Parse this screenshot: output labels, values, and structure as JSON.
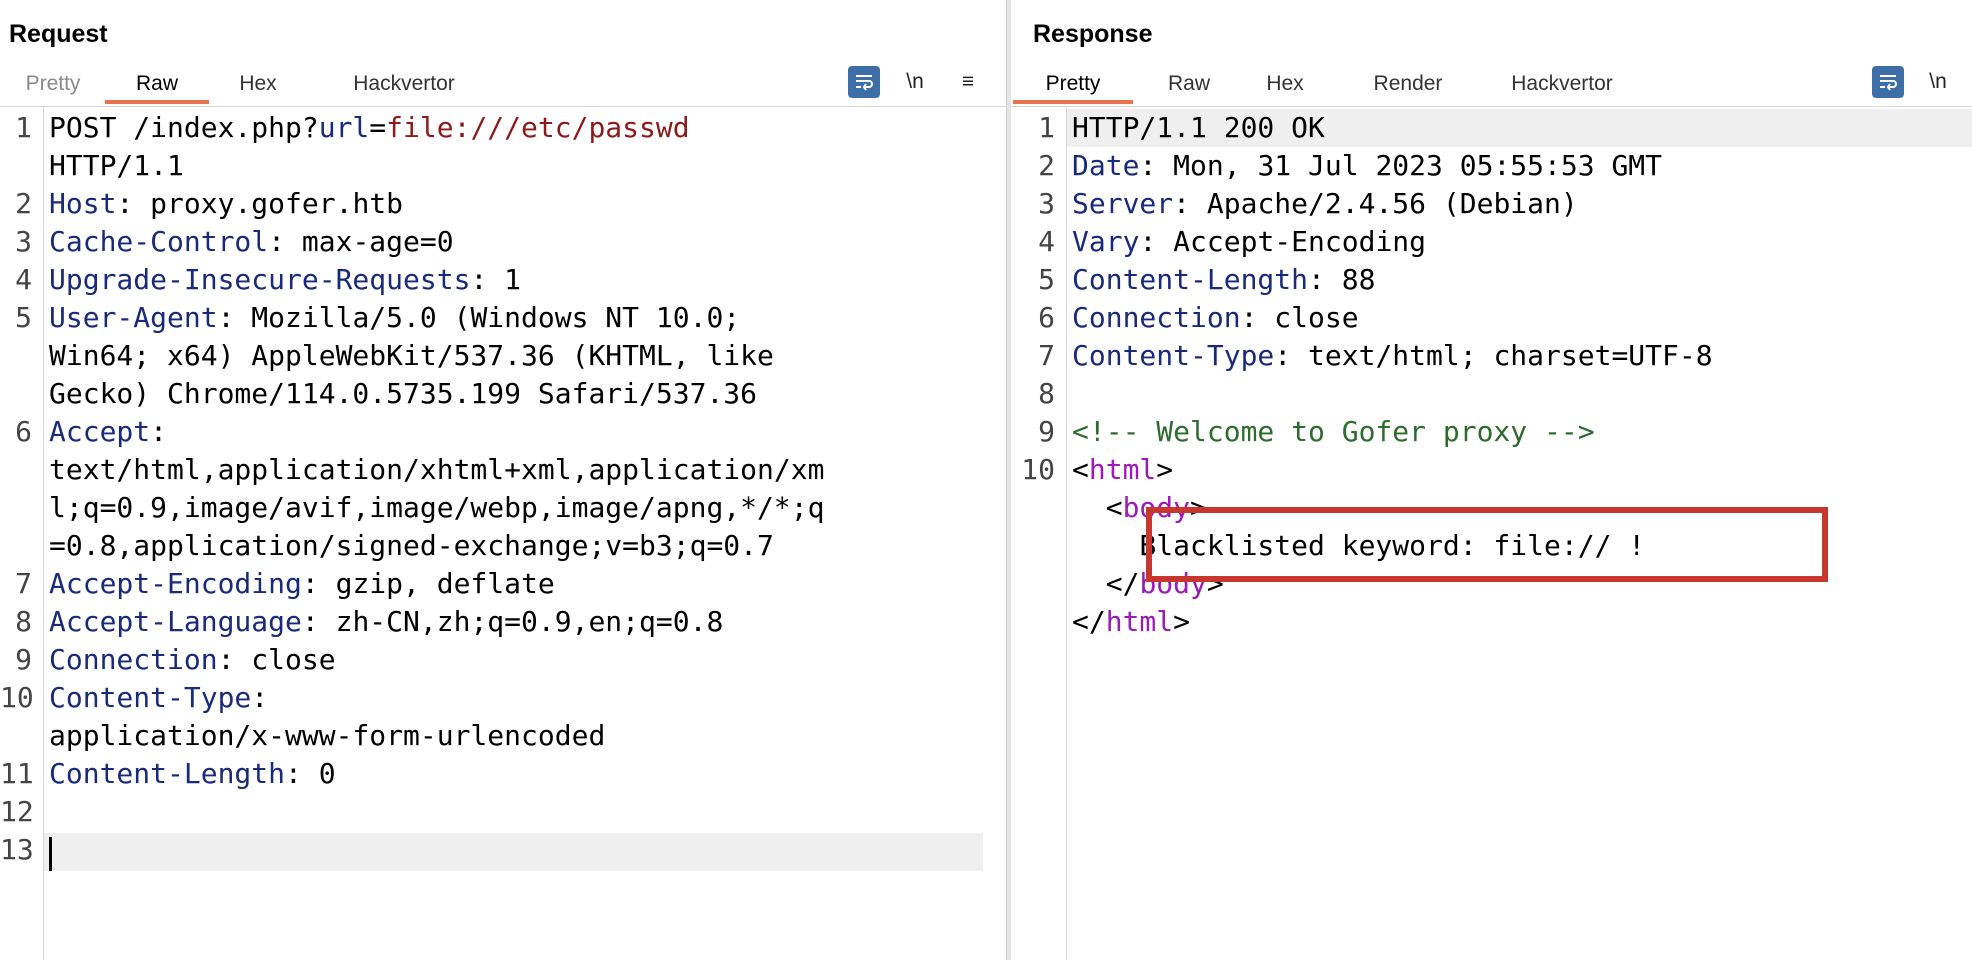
{
  "request": {
    "title": "Request",
    "tabs": [
      {
        "label": "Pretty",
        "active": false
      },
      {
        "label": "Raw",
        "active": true
      },
      {
        "label": "Hex",
        "active": false
      },
      {
        "label": "Hackvertor",
        "active": false
      }
    ],
    "toolbar": {
      "wrap_icon": "wrap-lines-icon",
      "newline_label": "\\n",
      "menu_icon": "hamburger-menu-icon"
    },
    "lines": [
      {
        "n": "1",
        "parts": [
          [
            "",
            "POST /index.php?"
          ],
          [
            "k",
            "url"
          ],
          [
            "",
            "="
          ],
          [
            "u",
            "file:///etc/passwd"
          ]
        ]
      },
      {
        "n": "",
        "parts": [
          [
            "",
            "HTTP/1.1"
          ]
        ]
      },
      {
        "n": "2",
        "parts": [
          [
            "k",
            "Host"
          ],
          [
            "",
            ": proxy.gofer.htb"
          ]
        ]
      },
      {
        "n": "3",
        "parts": [
          [
            "k",
            "Cache-Control"
          ],
          [
            "",
            ": max-age=0"
          ]
        ]
      },
      {
        "n": "4",
        "parts": [
          [
            "k",
            "Upgrade-Insecure-Requests"
          ],
          [
            "",
            ": 1"
          ]
        ]
      },
      {
        "n": "5",
        "parts": [
          [
            "k",
            "User-Agent"
          ],
          [
            "",
            ": Mozilla/5.0 (Windows NT 10.0;"
          ]
        ]
      },
      {
        "n": "",
        "parts": [
          [
            "",
            "Win64; x64) AppleWebKit/537.36 (KHTML, like"
          ]
        ]
      },
      {
        "n": "",
        "parts": [
          [
            "",
            "Gecko) Chrome/114.0.5735.199 Safari/537.36"
          ]
        ]
      },
      {
        "n": "6",
        "parts": [
          [
            "k",
            "Accept"
          ],
          [
            "",
            ":"
          ]
        ]
      },
      {
        "n": "",
        "parts": [
          [
            "",
            "text/html,application/xhtml+xml,application/xm"
          ]
        ]
      },
      {
        "n": "",
        "parts": [
          [
            "",
            "l;q=0.9,image/avif,image/webp,image/apng,*/*;q"
          ]
        ]
      },
      {
        "n": "",
        "parts": [
          [
            "",
            "=0.8,application/signed-exchange;v=b3;q=0.7"
          ]
        ]
      },
      {
        "n": "7",
        "parts": [
          [
            "k",
            "Accept-Encoding"
          ],
          [
            "",
            ": gzip, deflate"
          ]
        ]
      },
      {
        "n": "8",
        "parts": [
          [
            "k",
            "Accept-Language"
          ],
          [
            "",
            ": zh-CN,zh;q=0.9,en;q=0.8"
          ]
        ]
      },
      {
        "n": "9",
        "parts": [
          [
            "k",
            "Connection"
          ],
          [
            "",
            ": close"
          ]
        ]
      },
      {
        "n": "10",
        "parts": [
          [
            "k",
            "Content-Type"
          ],
          [
            "",
            ":"
          ]
        ]
      },
      {
        "n": "",
        "parts": [
          [
            "",
            "application/x-www-form-urlencoded"
          ]
        ]
      },
      {
        "n": "11",
        "parts": [
          [
            "k",
            "Content-Length"
          ],
          [
            "",
            ": 0"
          ]
        ]
      },
      {
        "n": "12",
        "parts": []
      },
      {
        "n": "13",
        "parts": []
      }
    ]
  },
  "response": {
    "title": "Response",
    "tabs": [
      {
        "label": "Pretty",
        "active": true
      },
      {
        "label": "Raw",
        "active": false
      },
      {
        "label": "Hex",
        "active": false
      },
      {
        "label": "Render",
        "active": false
      },
      {
        "label": "Hackvertor",
        "active": false
      }
    ],
    "toolbar": {
      "wrap_icon": "wrap-lines-icon",
      "newline_label": "\\n"
    },
    "lines": [
      {
        "n": "1",
        "parts": [
          [
            "",
            "HTTP/1.1 200 OK"
          ]
        ]
      },
      {
        "n": "2",
        "parts": [
          [
            "k",
            "Date"
          ],
          [
            "",
            ": Mon, 31 Jul 2023 05:55:53 GMT"
          ]
        ]
      },
      {
        "n": "3",
        "parts": [
          [
            "k",
            "Server"
          ],
          [
            "",
            ": Apache/2.4.56 (Debian)"
          ]
        ]
      },
      {
        "n": "4",
        "parts": [
          [
            "k",
            "Vary"
          ],
          [
            "",
            ": Accept-Encoding"
          ]
        ]
      },
      {
        "n": "5",
        "parts": [
          [
            "k",
            "Content-Length"
          ],
          [
            "",
            ": 88"
          ]
        ]
      },
      {
        "n": "6",
        "parts": [
          [
            "k",
            "Connection"
          ],
          [
            "",
            ": close"
          ]
        ]
      },
      {
        "n": "7",
        "parts": [
          [
            "k",
            "Content-Type"
          ],
          [
            "",
            ": text/html; charset=UTF-8"
          ]
        ]
      },
      {
        "n": "8",
        "parts": []
      },
      {
        "n": "9",
        "parts": [
          [
            "cm",
            "<!-- Welcome to Gofer proxy -->"
          ]
        ]
      },
      {
        "n": "10",
        "parts": [
          [
            "",
            "<"
          ],
          [
            "tg",
            "html"
          ],
          [
            "",
            ">"
          ]
        ]
      },
      {
        "n": "",
        "parts": [
          [
            "",
            "  <"
          ],
          [
            "tg",
            "body"
          ],
          [
            "",
            ">"
          ]
        ]
      },
      {
        "n": "",
        "parts": [
          [
            "",
            "    Blacklisted keyword: file:// !"
          ]
        ]
      },
      {
        "n": "",
        "parts": [
          [
            "",
            "  </"
          ],
          [
            "tg",
            "body"
          ],
          [
            "",
            ">"
          ]
        ]
      },
      {
        "n": "",
        "parts": [
          [
            "",
            "</"
          ],
          [
            "tg",
            "html"
          ],
          [
            "",
            ">"
          ]
        ]
      }
    ]
  },
  "layout_toggle": {
    "icons": [
      "split-horizontal-icon",
      "split-vertical-icon"
    ]
  },
  "colors": {
    "accent_tab": "#e8734d",
    "header_key": "#1a2a7a",
    "url_value": "#8b1a1a",
    "comment": "#2e6b2e",
    "tag": "#9c1ab8",
    "annotation_box": "#c8372d"
  }
}
